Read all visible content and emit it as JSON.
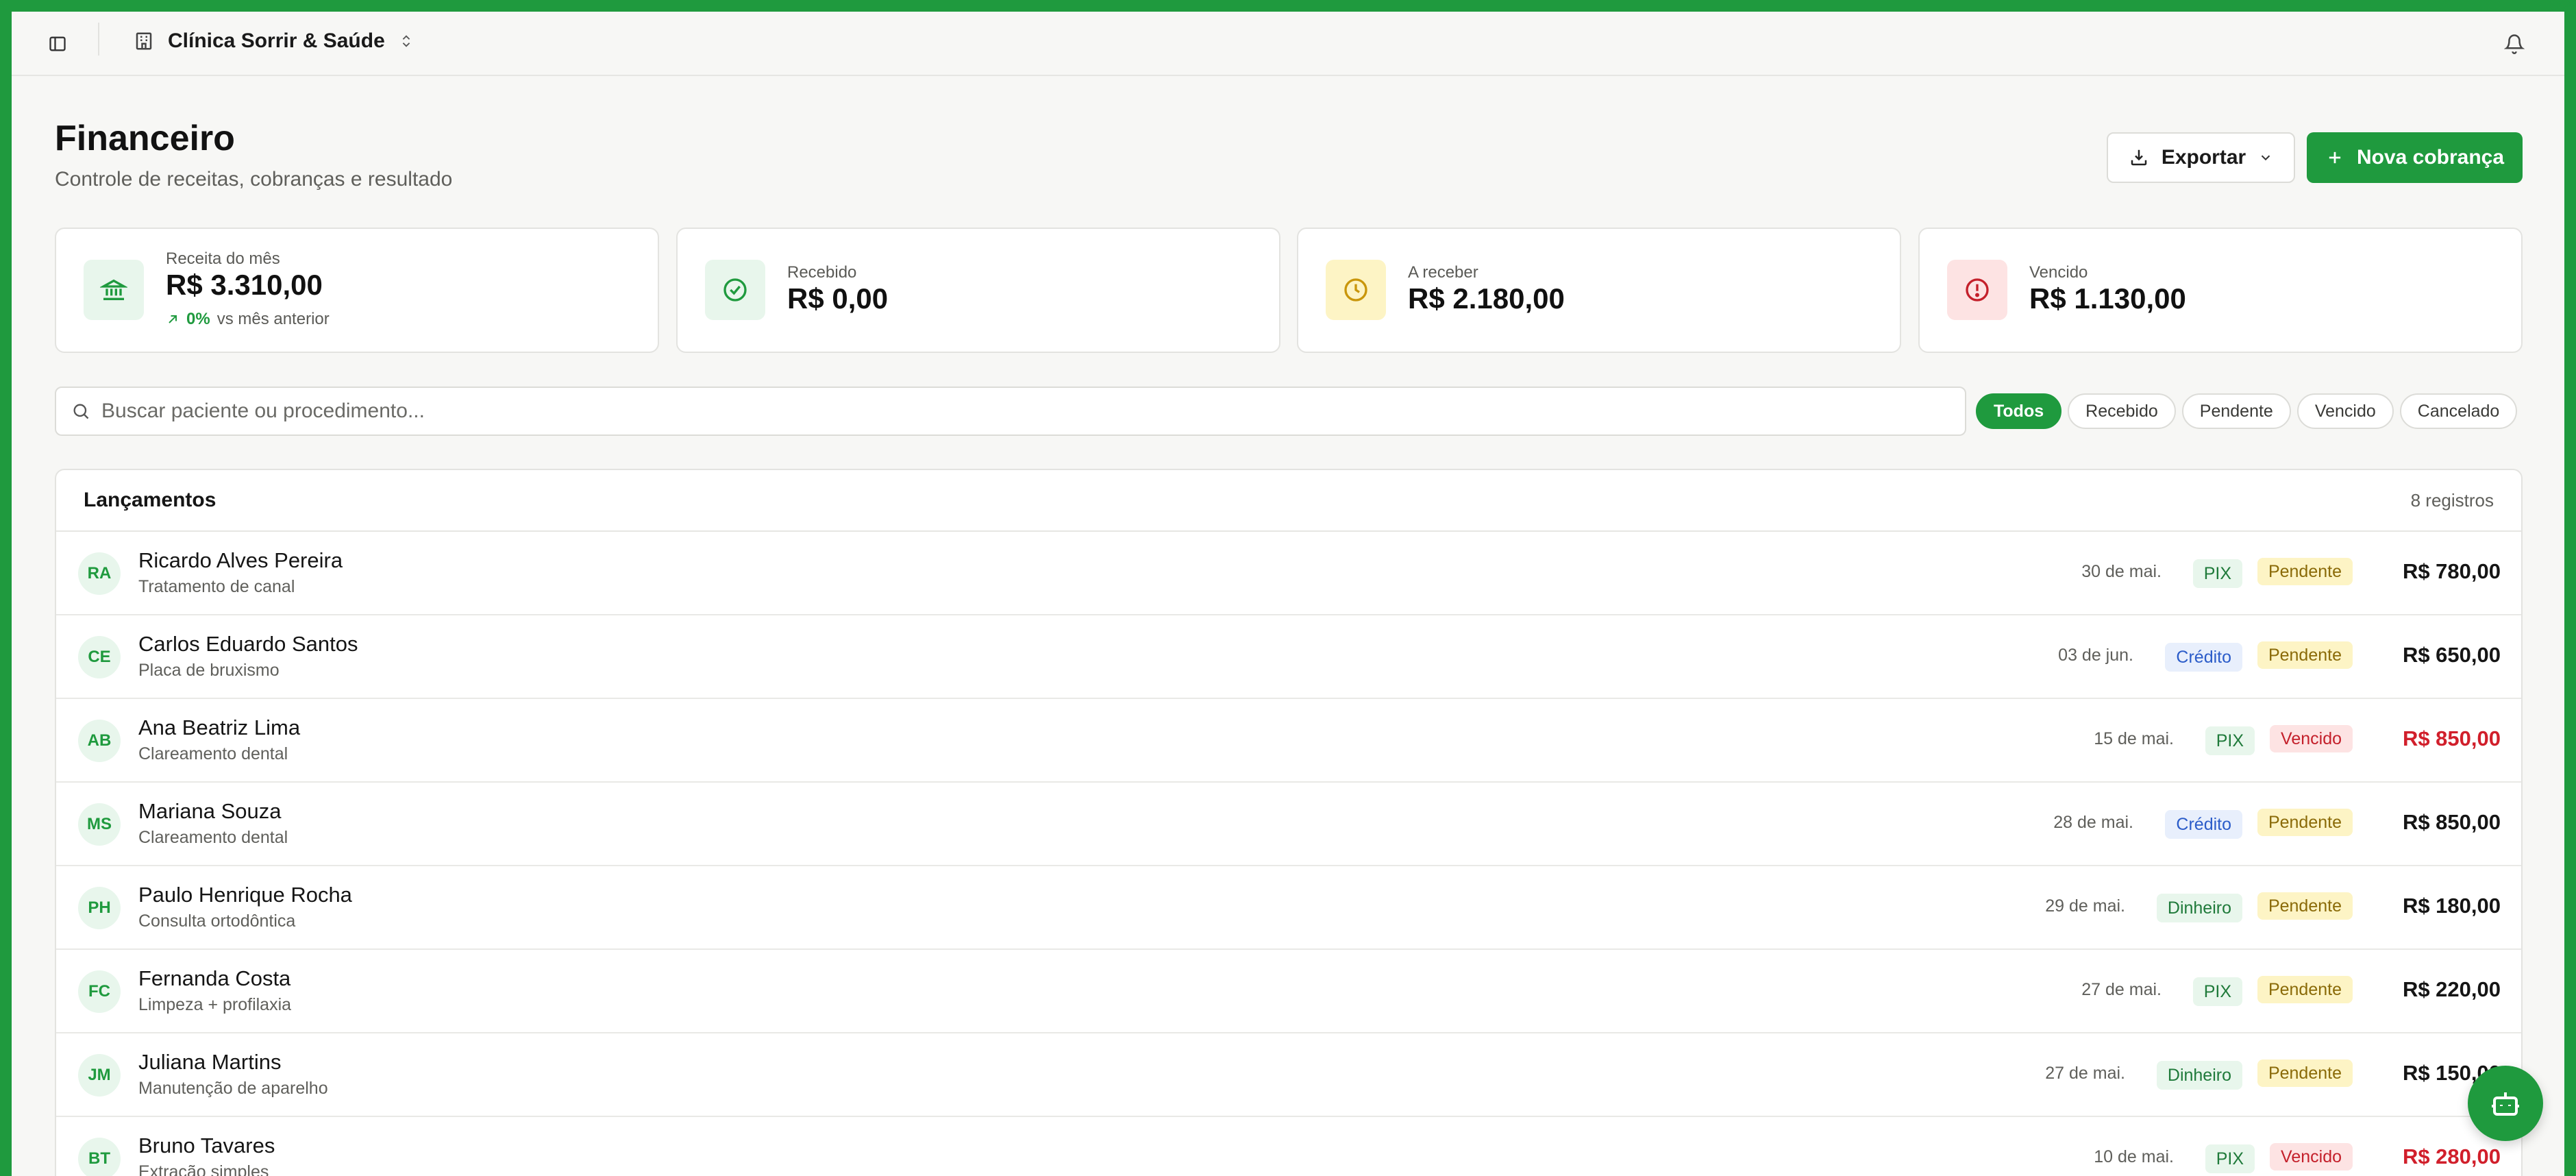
{
  "topbar": {
    "clinic_name": "Clínica Sorrir & Saúde"
  },
  "header": {
    "title": "Financeiro",
    "subtitle": "Controle de receitas, cobranças e resultado",
    "export_label": "Exportar",
    "new_charge_label": "Nova cobrança"
  },
  "stats": {
    "revenue": {
      "label": "Receita do mês",
      "value": "R$ 3.310,00",
      "trend": "0%",
      "trend_text": "vs mês anterior"
    },
    "received": {
      "label": "Recebido",
      "value": "R$ 0,00"
    },
    "receivable": {
      "label": "A receber",
      "value": "R$ 2.180,00"
    },
    "overdue": {
      "label": "Vencido",
      "value": "R$ 1.130,00"
    }
  },
  "search": {
    "placeholder": "Buscar paciente ou procedimento..."
  },
  "filters": [
    "Todos",
    "Recebido",
    "Pendente",
    "Vencido",
    "Cancelado"
  ],
  "table": {
    "title": "Lançamentos",
    "count": "8 registros",
    "rows": [
      {
        "initials": "RA",
        "name": "Ricardo Alves Pereira",
        "procedure": "Tratamento de canal",
        "date": "30 de mai.",
        "method": "PIX",
        "status": "Pendente",
        "amount": "R$ 780,00"
      },
      {
        "initials": "CE",
        "name": "Carlos Eduardo Santos",
        "procedure": "Placa de bruxismo",
        "date": "03 de jun.",
        "method": "Crédito",
        "status": "Pendente",
        "amount": "R$ 650,00"
      },
      {
        "initials": "AB",
        "name": "Ana Beatriz Lima",
        "procedure": "Clareamento dental",
        "date": "15 de mai.",
        "method": "PIX",
        "status": "Vencido",
        "amount": "R$ 850,00"
      },
      {
        "initials": "MS",
        "name": "Mariana Souza",
        "procedure": "Clareamento dental",
        "date": "28 de mai.",
        "method": "Crédito",
        "status": "Pendente",
        "amount": "R$ 850,00"
      },
      {
        "initials": "PH",
        "name": "Paulo Henrique Rocha",
        "procedure": "Consulta ortodôntica",
        "date": "29 de mai.",
        "method": "Dinheiro",
        "status": "Pendente",
        "amount": "R$ 180,00"
      },
      {
        "initials": "FC",
        "name": "Fernanda Costa",
        "procedure": "Limpeza + profilaxia",
        "date": "27 de mai.",
        "method": "PIX",
        "status": "Pendente",
        "amount": "R$ 220,00"
      },
      {
        "initials": "JM",
        "name": "Juliana Martins",
        "procedure": "Manutenção de aparelho",
        "date": "27 de mai.",
        "method": "Dinheiro",
        "status": "Pendente",
        "amount": "R$ 150,00"
      },
      {
        "initials": "BT",
        "name": "Bruno Tavares",
        "procedure": "Extração simples",
        "date": "10 de mai.",
        "method": "PIX",
        "status": "Vencido",
        "amount": "R$ 280,00"
      }
    ]
  },
  "colors": {
    "brand": "#1f9a3e",
    "pix_bg": "#e8f6ec",
    "pix_fg": "#1f7a3a",
    "credit_bg": "#e8effc",
    "credit_fg": "#2b5cc9",
    "cash_bg": "#e8f6ec",
    "cash_fg": "#1f7a3a",
    "pending_bg": "#fdf4c5",
    "pending_fg": "#8a6a08",
    "overdue_bg": "#fde3e3",
    "overdue_fg": "#c4202b"
  }
}
